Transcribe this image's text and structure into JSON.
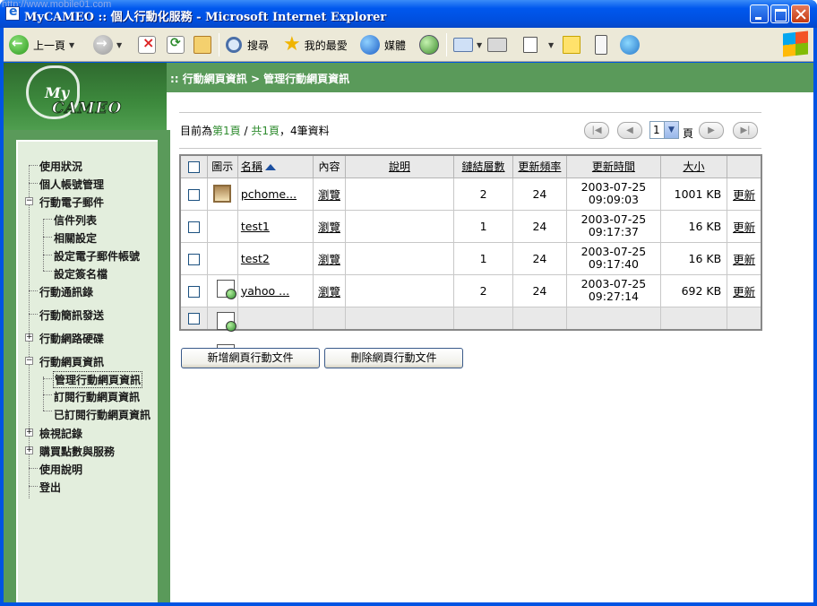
{
  "window": {
    "title": "MyCAMEO :: 個人行動化服務 - Microsoft Internet Explorer",
    "watermark": "http://www.mobile01.com"
  },
  "toolbar": {
    "back_label": "上一頁",
    "search_label": "搜尋",
    "favorites_label": "我的最愛",
    "media_label": "媒體"
  },
  "logo": {
    "line1": "My",
    "line2": "CAMEO"
  },
  "breadcrumb": ":: 行動網頁資訊 > 管理行動網頁資訊",
  "sidebar": {
    "items": [
      {
        "label": "使用狀況"
      },
      {
        "label": "個人帳號管理"
      },
      {
        "label": "行動電子郵件"
      },
      {
        "label": "信件列表"
      },
      {
        "label": "相關設定"
      },
      {
        "label": "設定電子郵件帳號"
      },
      {
        "label": "設定簽名檔"
      },
      {
        "label": "行動通訊錄"
      },
      {
        "label": "行動簡訊發送"
      },
      {
        "label": "行動網路硬碟"
      },
      {
        "label": "行動網頁資訊"
      },
      {
        "label": "管理行動網頁資訊"
      },
      {
        "label": "訂閱行動網頁資訊"
      },
      {
        "label": "已訂閱行動網頁資訊"
      },
      {
        "label": "檢視記錄"
      },
      {
        "label": "購買點數與服務"
      },
      {
        "label": "使用說明"
      },
      {
        "label": "登出"
      }
    ]
  },
  "status": {
    "prefix": "目前為",
    "current_page": "第1頁",
    "sep": " / ",
    "total_pages": "共1頁",
    "count": "，4筆資料"
  },
  "pager": {
    "selected_page": "1",
    "unit": "頁"
  },
  "table": {
    "headers": {
      "icon": "圖示",
      "name": "名稱",
      "content": "內容",
      "desc": "說明",
      "depth": "鏈結層數",
      "freq": "更新頻率",
      "time": "更新時間",
      "size": "大小"
    },
    "rows": [
      {
        "icon": "picture",
        "name": "pchome...",
        "view": "瀏覽",
        "desc": "",
        "depth": "2",
        "freq": "24",
        "date": "2003-07-25",
        "time": "09:09:03",
        "size": "1001 KB",
        "action": "更新"
      },
      {
        "icon": "page",
        "name": "test1",
        "view": "瀏覽",
        "desc": "",
        "depth": "1",
        "freq": "24",
        "date": "2003-07-25",
        "time": "09:17:37",
        "size": "16 KB",
        "action": "更新"
      },
      {
        "icon": "page",
        "name": "test2",
        "view": "瀏覽",
        "desc": "",
        "depth": "1",
        "freq": "24",
        "date": "2003-07-25",
        "time": "09:17:40",
        "size": "16 KB",
        "action": "更新"
      },
      {
        "icon": "page",
        "name": "yahoo ...",
        "view": "瀏覽",
        "desc": "",
        "depth": "2",
        "freq": "24",
        "date": "2003-07-25",
        "time": "09:27:14",
        "size": "692 KB",
        "action": "更新"
      }
    ]
  },
  "buttons": {
    "add": "新增網頁行動文件",
    "delete": "刪除網頁行動文件"
  },
  "colors": {
    "brand_green": "#5a9a5a",
    "sidebar_bg": "#e3eedd",
    "link_green": "#2e8b2e"
  }
}
